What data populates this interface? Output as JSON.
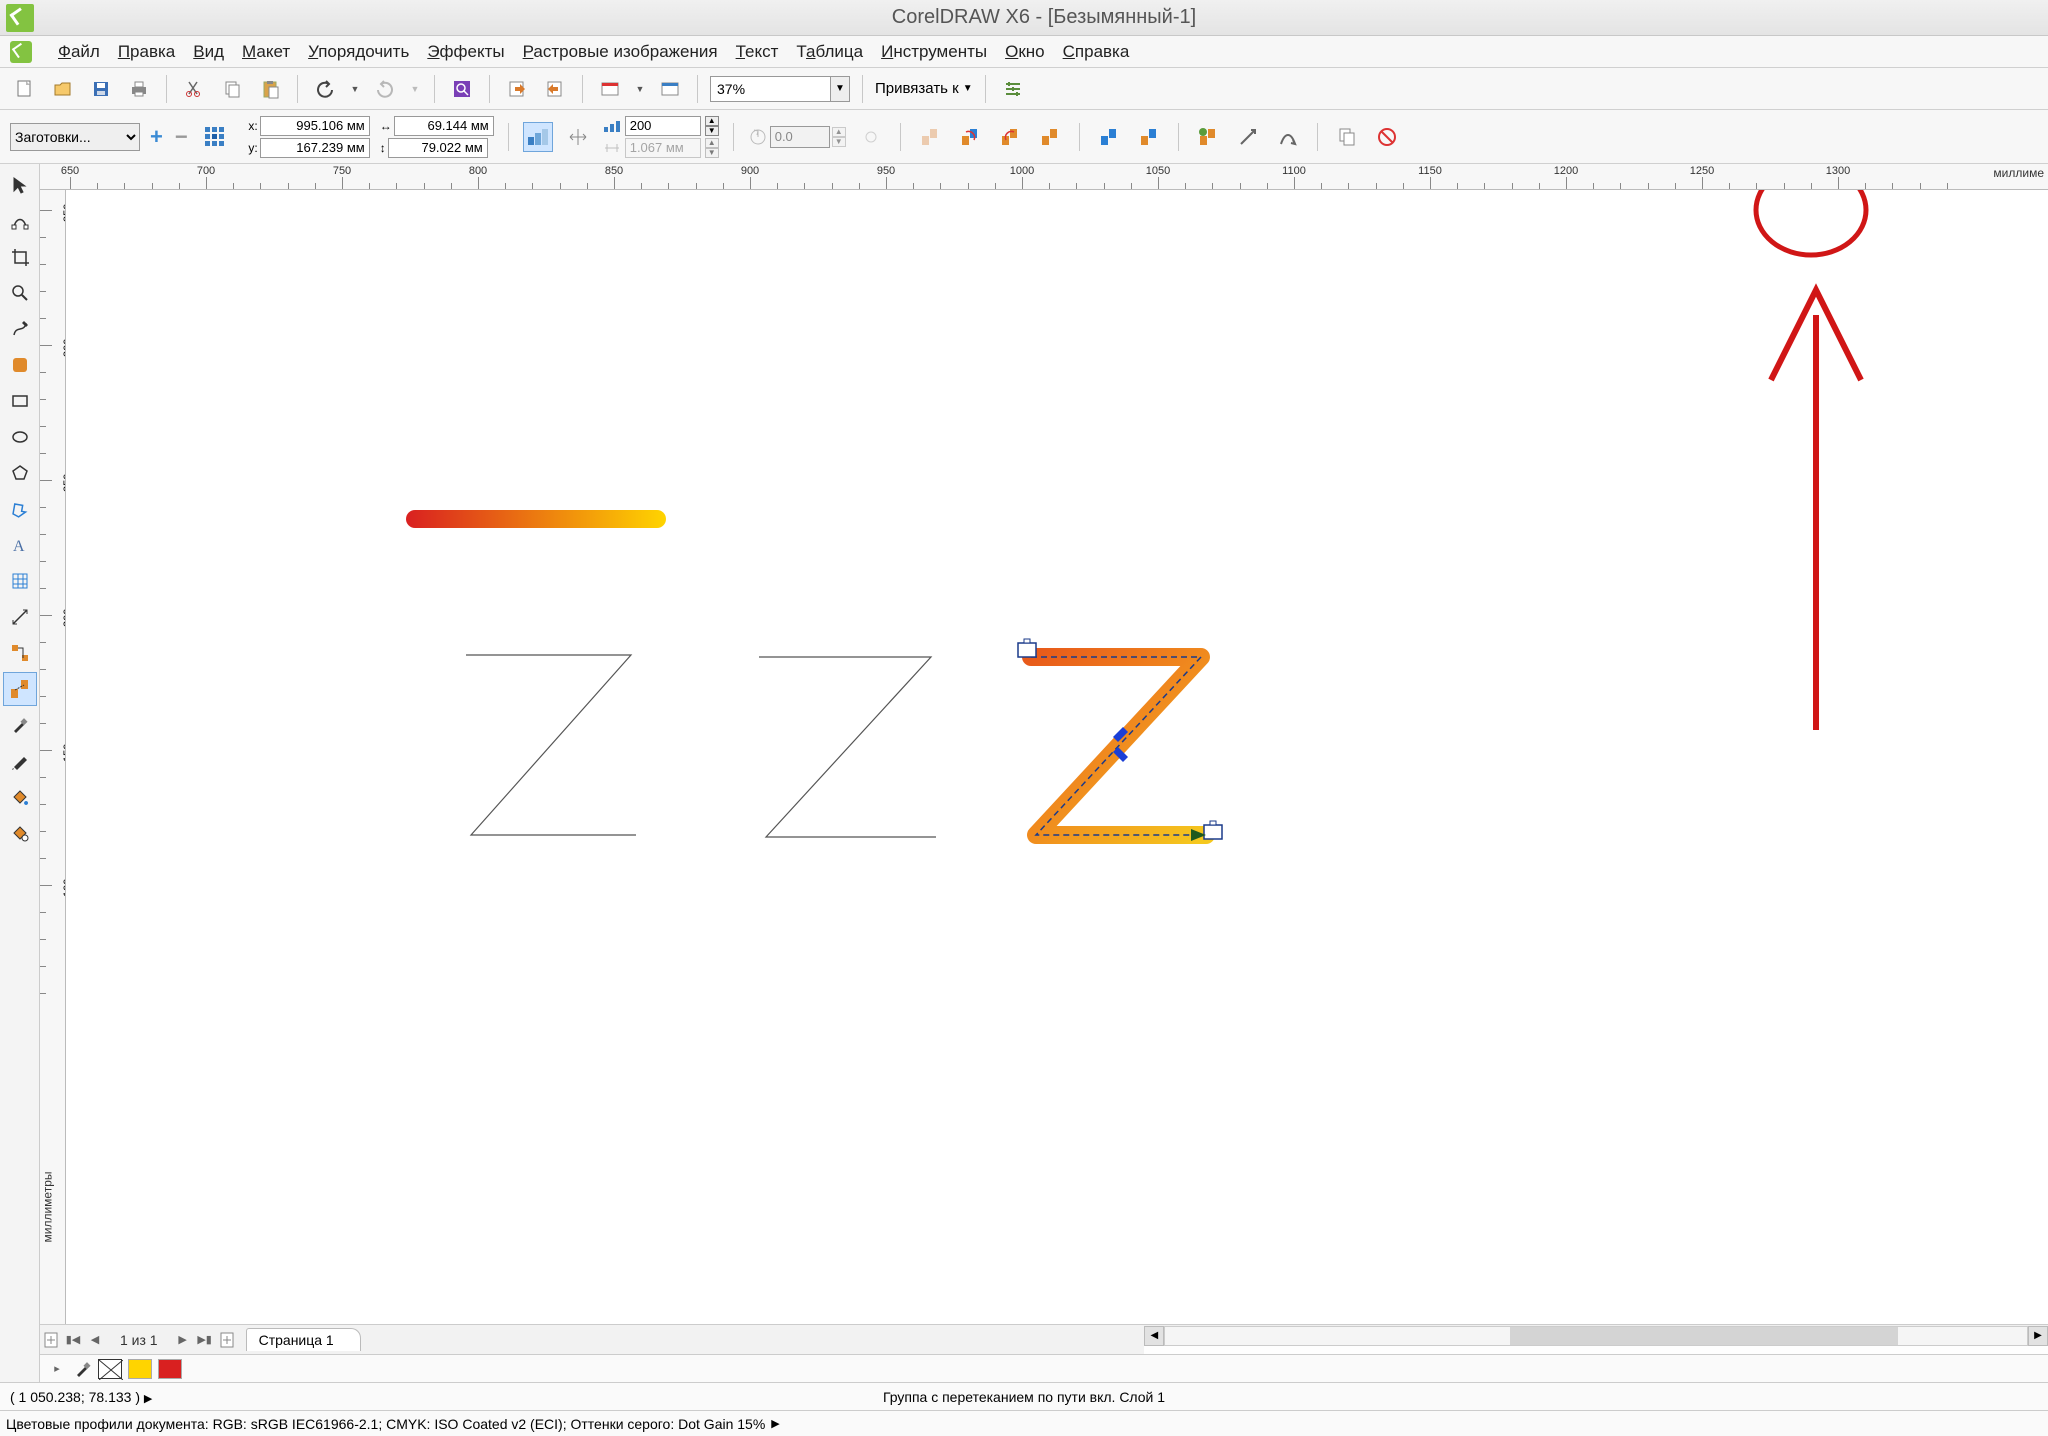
{
  "title": "CorelDRAW X6 - [Безымянный-1]",
  "menu": [
    "Файл",
    "Правка",
    "Вид",
    "Макет",
    "Упорядочить",
    "Эффекты",
    "Растровые изображения",
    "Текст",
    "Таблица",
    "Инструменты",
    "Окно",
    "Справка"
  ],
  "toolbar": {
    "zoom": "37%",
    "snap_to": "Привязать к"
  },
  "propbar": {
    "presets": "Заготовки...",
    "x": "995.106 мм",
    "y": "167.239 мм",
    "w": "69.144 мм",
    "h": "79.022 мм",
    "steps": "200",
    "step2": "1.067 мм",
    "rotation": "0.0"
  },
  "ruler_h": {
    "start": 650,
    "step": 50,
    "count": 14,
    "unit": "миллиме"
  },
  "ruler_v": {
    "values": [
      350,
      300,
      250,
      200,
      150,
      100
    ],
    "unit": "миллиметры"
  },
  "page_nav": {
    "label": "1 из 1",
    "tab": "Страница 1"
  },
  "status": {
    "cursor": "( 1 050.238; 78.133 )",
    "selection": "Группа с перетеканием по пути вкл. Слой 1",
    "profiles": "Цветовые профили документа: RGB: sRGB IEC61966-2.1; CMYK: ISO Coated v2 (ECI); Оттенки серого: Dot Gain 15%"
  },
  "palette_colors": [
    "#ffffff",
    "#ffd400",
    "#d92020"
  ]
}
